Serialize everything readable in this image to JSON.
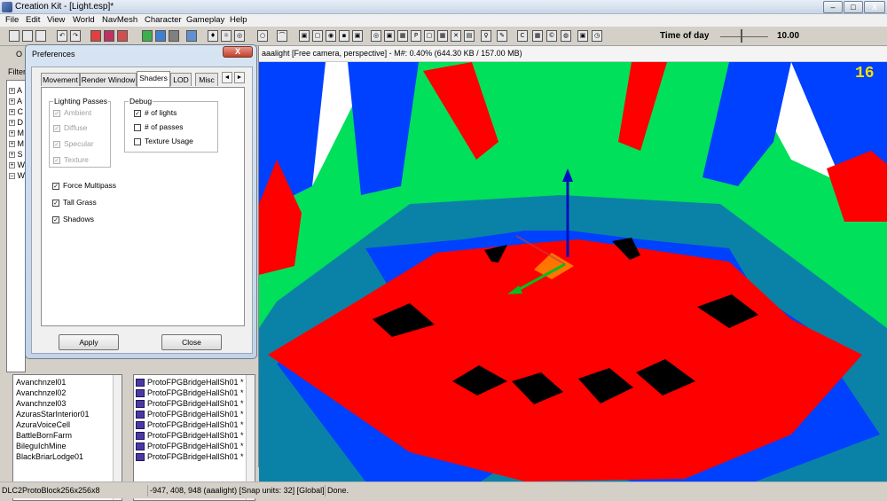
{
  "window": {
    "title": "Creation Kit - [Light.esp]*",
    "close_glyph": "X",
    "min_glyph": "–",
    "max_glyph": "□"
  },
  "menu": [
    "File",
    "Edit",
    "View",
    "World",
    "NavMesh",
    "Character",
    "Gameplay",
    "Help"
  ],
  "toolbar": {
    "time_of_day_label": "Time of day",
    "time_of_day_value": "10.00",
    "time_of_day_fraction": 0.42
  },
  "object_window": {
    "title": "O",
    "filter_label": "Filter",
    "tree_boxes": [
      "+",
      "+",
      "+",
      "+",
      "+",
      "+",
      "+",
      "+",
      "–"
    ],
    "tree_letters": [
      "A",
      "A",
      "C",
      "D",
      "M",
      "M",
      "S",
      "W",
      "W"
    ],
    "cells": [
      "Avanchnzel01",
      "Avanchnzel02",
      "Avanchnzel03",
      "AzurasStarInterior01",
      "AzuraVoiceCell",
      "BattleBornFarm",
      "BileguIchMine",
      "BlackBriarLodge01"
    ],
    "objects": [
      "ProtoFPGBridgeHallSh01 *",
      "ProtoFPGBridgeHallSh01 *",
      "ProtoFPGBridgeHallSh01 *",
      "ProtoFPGBridgeHallSh01 *",
      "ProtoFPGBridgeHallSh01 *",
      "ProtoFPGBridgeHallSh01 *",
      "ProtoFPGBridgeHallSh01 *",
      "ProtoFPGBridgeHallSh01 *"
    ]
  },
  "preferences": {
    "title": "Preferences",
    "close_glyph": "X",
    "tabs": [
      "Movement",
      "Render Window",
      "Shaders",
      "LOD",
      "Misc"
    ],
    "active_tab": "Shaders",
    "tab_scroll_left": "◄",
    "tab_scroll_right": "►",
    "lighting_passes": {
      "label": "Lighting Passes",
      "items": [
        {
          "label": "Ambient",
          "checked": true,
          "enabled": false
        },
        {
          "label": "Diffuse",
          "checked": true,
          "enabled": false
        },
        {
          "label": "Specular",
          "checked": true,
          "enabled": false
        },
        {
          "label": "Texture",
          "checked": true,
          "enabled": false
        }
      ]
    },
    "debug": {
      "label": "Debug",
      "items": [
        {
          "label": "# of lights",
          "checked": true
        },
        {
          "label": "# of passes",
          "checked": false
        },
        {
          "label": "Texture Usage",
          "checked": false
        }
      ]
    },
    "options": [
      {
        "label": "Force Multipass",
        "checked": true
      },
      {
        "label": "Tall Grass",
        "checked": true
      },
      {
        "label": "Shadows",
        "checked": true
      }
    ],
    "apply_label": "Apply",
    "close_label": "Close"
  },
  "viewport": {
    "title": "aaalight [Free camera, perspective] - M#: 0.40% (644.30 KB / 157.00 MB)",
    "fps": "16",
    "colors": {
      "sky": "#ffffff",
      "red": "#ff0000",
      "green": "#00e05a",
      "blue": "#0040ff",
      "teal": "#0a82a8",
      "black": "#000000"
    }
  },
  "status": {
    "cell": "DLC2ProtoBlock256x256x8",
    "coords": "-947, 408, 948 (aaalight) [Snap units: 32] [Global]",
    "message": "Done."
  }
}
